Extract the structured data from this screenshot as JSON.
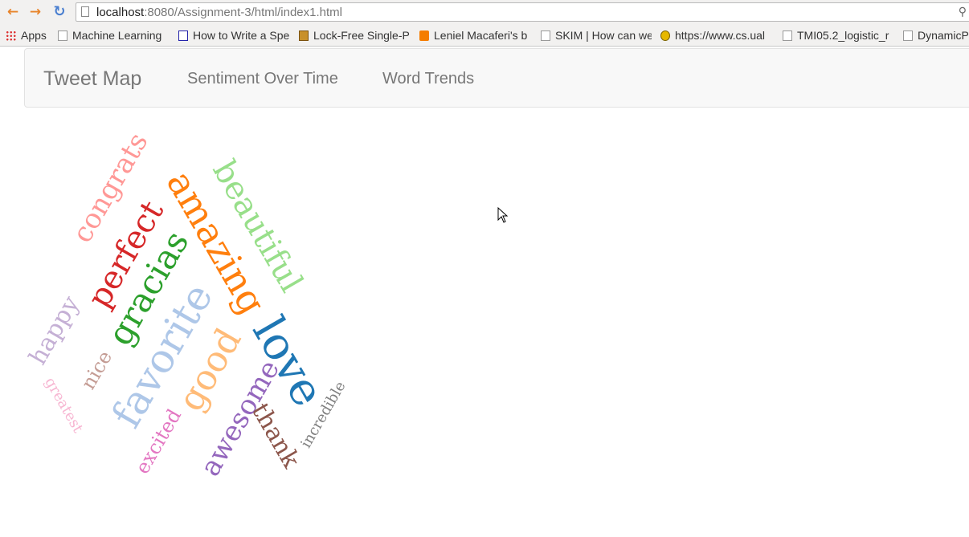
{
  "browser": {
    "url_host": "localhost",
    "url_rest": ":8080/Assignment-3/html/index1.html",
    "bookmarks": [
      "Apps",
      "Machine Learning",
      "How to Write a Spe",
      "Lock-Free Single-P",
      "Leniel Macaferi's b",
      "SKIM | How can we",
      "https://www.cs.ual",
      "TMI05.2_logistic_r",
      "DynamicP"
    ]
  },
  "navbar": {
    "brand": "Tweet Map",
    "links": [
      "Sentiment Over Time",
      "Word Trends"
    ]
  },
  "cloud": {
    "words": [
      {
        "text": "congrats",
        "color": "#ff9896"
      },
      {
        "text": "perfect",
        "color": "#d62728"
      },
      {
        "text": "amazing",
        "color": "#ff7f0e"
      },
      {
        "text": "beautiful",
        "color": "#98df8a"
      },
      {
        "text": "gracias",
        "color": "#2ca02c"
      },
      {
        "text": "happy",
        "color": "#c5b0d5"
      },
      {
        "text": "favorite",
        "color": "#aec7e8"
      },
      {
        "text": "nice",
        "color": "#c49c94"
      },
      {
        "text": "good",
        "color": "#ffbb78"
      },
      {
        "text": "love",
        "color": "#1f77b4"
      },
      {
        "text": "greatest",
        "color": "#f7b6d2"
      },
      {
        "text": "awesome",
        "color": "#9467bd"
      },
      {
        "text": "excited",
        "color": "#e377c2"
      },
      {
        "text": "thank",
        "color": "#8c564b"
      },
      {
        "text": "incredible",
        "color": "#7f7f7f"
      }
    ]
  }
}
